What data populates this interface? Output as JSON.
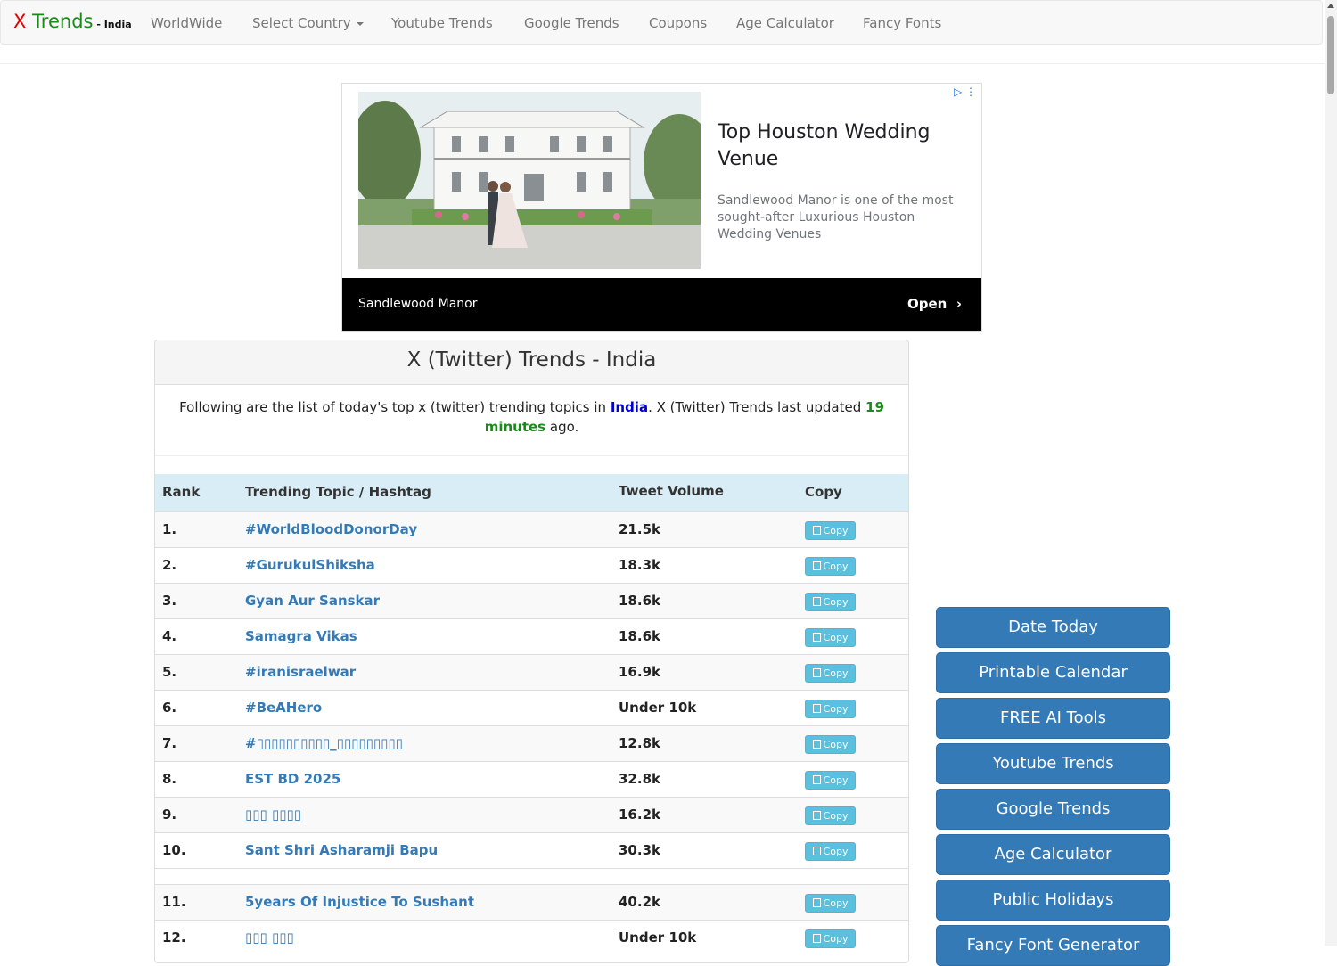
{
  "nav": {
    "brand_x": "X",
    "brand_trends": " Trends",
    "brand_sub": " - India",
    "items": [
      "WorldWide",
      "Select Country",
      "Youtube Trends",
      "Google Trends",
      "Coupons",
      "Age Calculator",
      "Fancy Fonts"
    ]
  },
  "ad": {
    "headline": "Top Houston Wedding Venue",
    "description": "Sandlewood Manor is one of the most sought-after Luxurious Houston Wedding Venues",
    "advertiser": "Sandlewood Manor",
    "cta": "Open",
    "cta_arrow": "›"
  },
  "panel": {
    "title": "X (Twitter) Trends - India",
    "intro_before": "Following are the list of today's top x (twitter) trending topics in ",
    "country": "India",
    "intro_mid": ". X (Twitter) Trends last updated ",
    "minutes": "19 minutes",
    "intro_after": " ago."
  },
  "table": {
    "headers": {
      "rank": "Rank",
      "topic": "Trending Topic / Hashtag",
      "volume": "Tweet Volume",
      "copy": "Copy"
    },
    "copy_label": "Copy",
    "rows": [
      {
        "rank": "1.",
        "topic": "#WorldBloodDonorDay",
        "volume": "21.5k"
      },
      {
        "rank": "2.",
        "topic": "#GurukulShiksha",
        "volume": "18.3k"
      },
      {
        "rank": "3.",
        "topic": "Gyan Aur Sanskar",
        "volume": "18.6k"
      },
      {
        "rank": "4.",
        "topic": "Samagra Vikas",
        "volume": "18.6k"
      },
      {
        "rank": "5.",
        "topic": "#iranisraelwar",
        "volume": "16.9k"
      },
      {
        "rank": "6.",
        "topic": "#BeAHero",
        "volume": "Under 10k"
      },
      {
        "rank": "7.",
        "topic": "#▯▯▯▯▯▯▯▯▯▯_▯▯▯▯▯▯▯▯▯",
        "volume": "12.8k"
      },
      {
        "rank": "8.",
        "topic": "EST BD 2025",
        "volume": "32.8k"
      },
      {
        "rank": "9.",
        "topic": "▯▯▯ ▯▯▯▯",
        "volume": "16.2k"
      },
      {
        "rank": "10.",
        "topic": "Sant Shri Asharamji Bapu",
        "volume": "30.3k"
      },
      {
        "rank": "11.",
        "topic": "5years Of Injustice To Sushant",
        "volume": "40.2k"
      },
      {
        "rank": "12.",
        "topic": "▯▯▯ ▯▯▯",
        "volume": "Under 10k"
      }
    ]
  },
  "sidebar": {
    "buttons": [
      "Date Today",
      "Printable Calendar",
      "FREE AI Tools",
      "Youtube Trends",
      "Google Trends",
      "Age Calculator",
      "Public Holidays",
      "Fancy Font Generator"
    ]
  },
  "colors": {
    "link": "#337ab7",
    "thead_bg": "#d9edf7",
    "copy_btn": "#5bc0de",
    "sidebar_btn": "#337ab7",
    "brand_red": "#e00000",
    "brand_green": "#1a8a1a"
  }
}
